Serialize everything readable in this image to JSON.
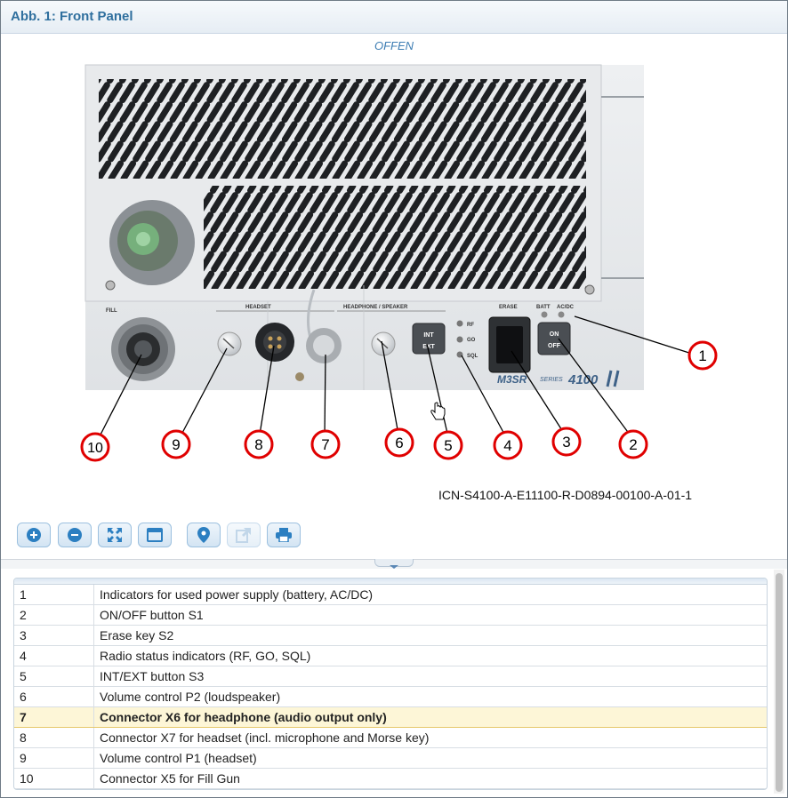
{
  "header": {
    "title": "Abb. 1: Front Panel"
  },
  "figure": {
    "status": "OFFEN",
    "icn": "ICN-S4100-A-E11100-R-D0894-00100-A-01-1",
    "panel_labels": {
      "fill": "FILL",
      "headset": "HEADSET",
      "headphone_speaker": "HEADPHONE / SPEAKER",
      "erase": "ERASE",
      "batt": "BATT",
      "acdc": "AC/DC",
      "rf": "RF",
      "go": "GO",
      "sql": "SQL",
      "int": "INT",
      "ext": "EXT",
      "on": "ON",
      "off": "OFF",
      "brand": "M3SR",
      "series": "SERIES",
      "model": "4100"
    },
    "callouts": [
      "1",
      "2",
      "3",
      "4",
      "5",
      "6",
      "7",
      "8",
      "9",
      "10"
    ]
  },
  "toolbar": {
    "zoom_in": "zoom-in-icon",
    "zoom_out": "zoom-out-icon",
    "fit": "fit-screen-icon",
    "window": "window-icon",
    "locate": "map-pin-icon",
    "open_external": "external-link-icon",
    "print": "print-icon"
  },
  "legend": {
    "selected_index": 6,
    "rows": [
      {
        "num": "1",
        "text": "Indicators for used power supply (battery, AC/DC)"
      },
      {
        "num": "2",
        "text": "ON/OFF button S1"
      },
      {
        "num": "3",
        "text": "Erase key S2"
      },
      {
        "num": "4",
        "text": "Radio status indicators (RF, GO, SQL)"
      },
      {
        "num": "5",
        "text": "INT/EXT button S3"
      },
      {
        "num": "6",
        "text": "Volume control P2 (loudspeaker)"
      },
      {
        "num": "7",
        "text": "Connector X6 for headphone (audio output only)"
      },
      {
        "num": "8",
        "text": "Connector X7 for headset (incl. microphone and Morse key)"
      },
      {
        "num": "9",
        "text": "Volume control P1 (headset)"
      },
      {
        "num": "10",
        "text": "Connector X5 for Fill Gun"
      }
    ]
  },
  "colors": {
    "accent": "#2f6f9e",
    "callout_ring": "#e00000",
    "selected_row": "#fdf6d7"
  }
}
